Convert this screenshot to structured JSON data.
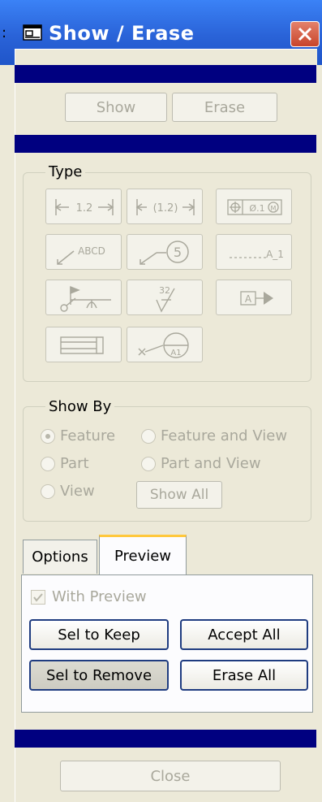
{
  "window": {
    "title": "Show / Erase",
    "icon": "window-app-icon",
    "close_icon": "close-icon"
  },
  "top_buttons": {
    "show": "Show",
    "erase": "Erase"
  },
  "type_group": {
    "label": "Type",
    "buttons": [
      "dimension-icon",
      "reference-dimension-icon",
      "geometric-tolerance-icon",
      "note-icon",
      "balloon-icon",
      "axis-icon",
      "symbol-icon",
      "surface-finish-icon",
      "datum-target-icon",
      "cosmetic-feature-icon",
      "datum-target-balloon-icon"
    ]
  },
  "show_by": {
    "label": "Show By",
    "options": [
      "Feature",
      "Feature and View",
      "Part",
      "Part and View",
      "View"
    ],
    "selected": "Feature",
    "show_all": "Show All"
  },
  "tabs": {
    "options": "Options",
    "preview": "Preview",
    "active": "Preview"
  },
  "preview": {
    "with_preview": "With Preview",
    "sel_to_keep": "Sel to Keep",
    "accept_all": "Accept All",
    "sel_to_remove": "Sel to Remove",
    "erase_all": "Erase All"
  },
  "footer": {
    "close": "Close"
  },
  "colors": {
    "title_bar": "#2a63d8",
    "accent_bar": "#000080",
    "dialog_bg": "#ece9d8",
    "tab_highlight": "#ffc83c"
  }
}
